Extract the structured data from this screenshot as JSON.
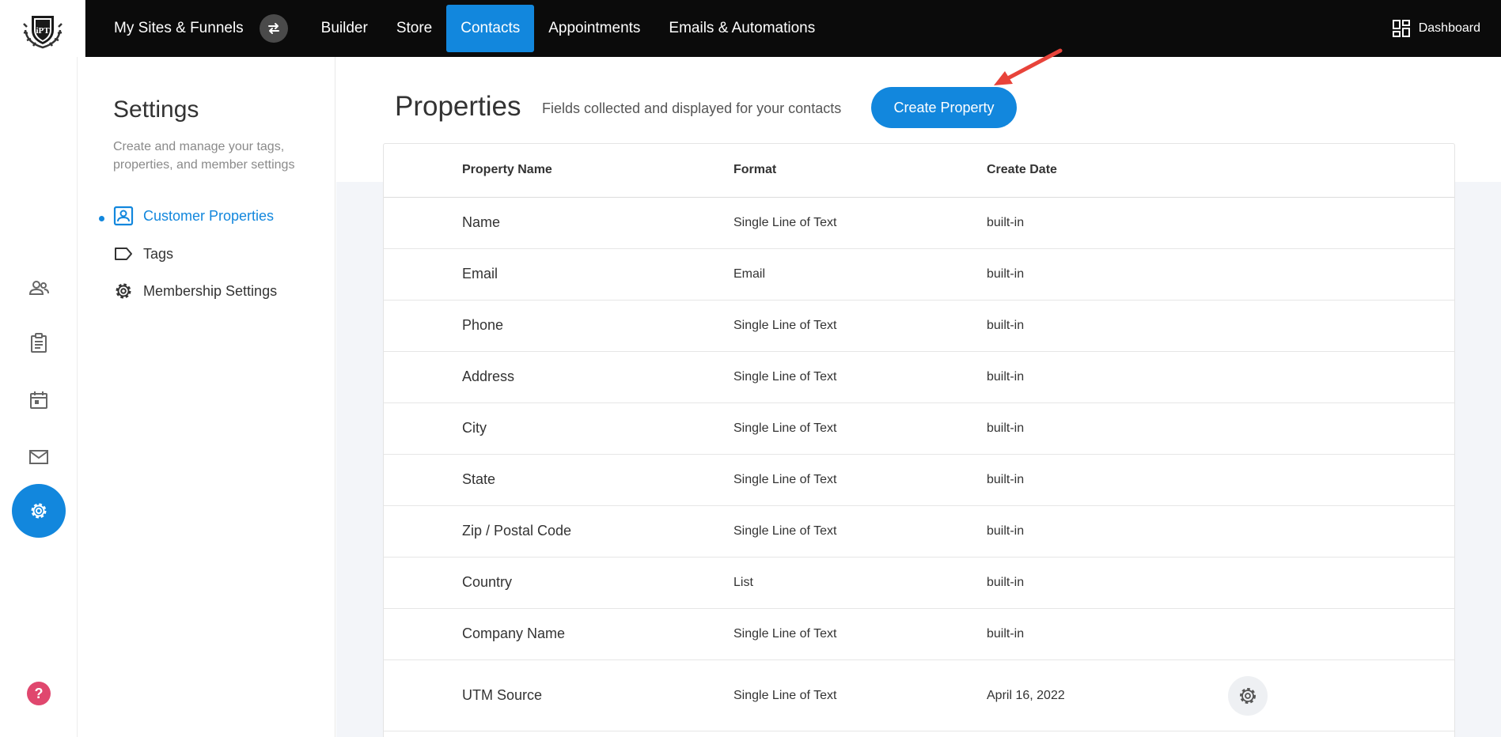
{
  "logo": {
    "text": "iPT"
  },
  "nav": {
    "items": [
      {
        "label": "My Sites & Funnels",
        "active": false
      },
      {
        "label": "Builder",
        "active": false
      },
      {
        "label": "Store",
        "active": false
      },
      {
        "label": "Contacts",
        "active": true
      },
      {
        "label": "Appointments",
        "active": false
      },
      {
        "label": "Emails & Automations",
        "active": false
      }
    ],
    "dashboard_label": "Dashboard"
  },
  "rail": {
    "icons": [
      "contacts-icon",
      "clipboard-icon",
      "calendar-icon",
      "mail-icon",
      "settings-icon",
      "help-icon"
    ],
    "help_label": "?"
  },
  "settings": {
    "title": "Settings",
    "description": "Create and manage your tags, properties, and member settings",
    "menu": [
      {
        "label": "Customer Properties",
        "icon": "contact-card-icon",
        "active": true
      },
      {
        "label": "Tags",
        "icon": "tag-icon",
        "active": false
      },
      {
        "label": "Membership Settings",
        "icon": "gear-icon",
        "active": false
      }
    ]
  },
  "main": {
    "title": "Properties",
    "subtitle": "Fields collected and displayed for your contacts",
    "create_button": "Create Property",
    "table": {
      "headers": [
        "Property Name",
        "Format",
        "Create Date"
      ],
      "rows": [
        {
          "name": "Name",
          "format": "Single Line of Text",
          "date": "built-in"
        },
        {
          "name": "Email",
          "format": "Email",
          "date": "built-in"
        },
        {
          "name": "Phone",
          "format": "Single Line of Text",
          "date": "built-in"
        },
        {
          "name": "Address",
          "format": "Single Line of Text",
          "date": "built-in"
        },
        {
          "name": "City",
          "format": "Single Line of Text",
          "date": "built-in"
        },
        {
          "name": "State",
          "format": "Single Line of Text",
          "date": "built-in"
        },
        {
          "name": "Zip / Postal Code",
          "format": "Single Line of Text",
          "date": "built-in"
        },
        {
          "name": "Country",
          "format": "List",
          "date": "built-in"
        },
        {
          "name": "Company Name",
          "format": "Single Line of Text",
          "date": "built-in"
        },
        {
          "name": "UTM Source",
          "format": "Single Line of Text",
          "date": "April 16, 2022"
        }
      ]
    }
  },
  "colors": {
    "accent": "#1287dd",
    "topbar": "#0b0b0b",
    "help": "#e0476e",
    "annotation_arrow": "#e8433a"
  }
}
